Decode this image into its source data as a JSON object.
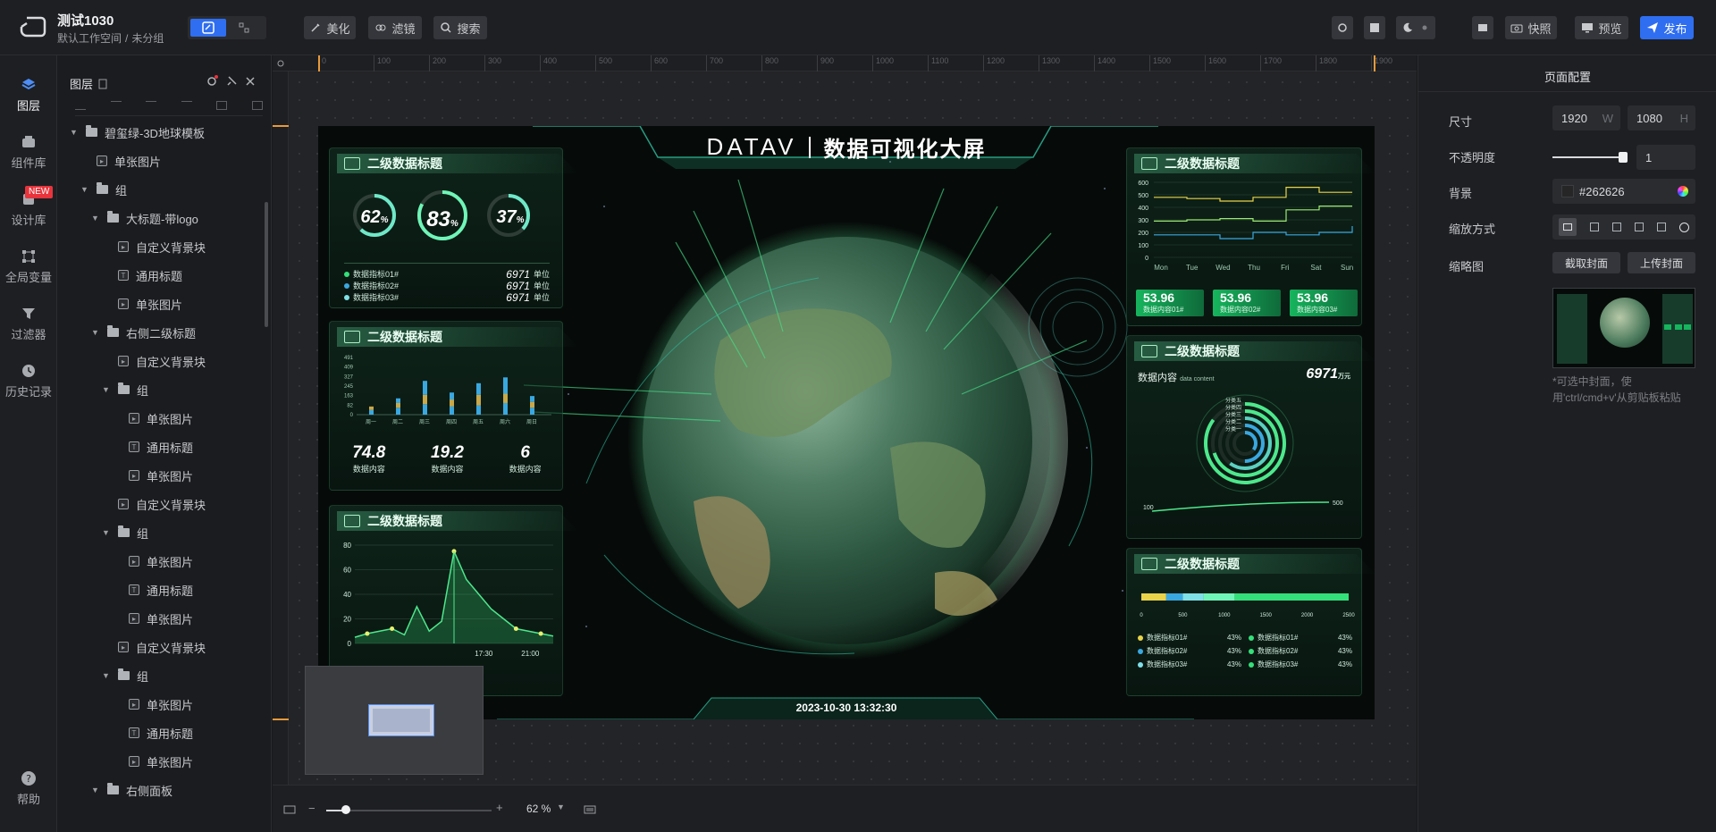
{
  "project": {
    "title": "测试1030",
    "workspace": "默认工作空间",
    "separator": "/",
    "group": "未分组"
  },
  "toolbar": {
    "beautify": "美化",
    "filter": "滤镜",
    "search": "搜索",
    "snapshot": "快照",
    "preview": "预览",
    "publish": "发布"
  },
  "leftnav": [
    {
      "label": "图层",
      "icon": "layers-icon"
    },
    {
      "label": "组件库",
      "icon": "component-icon"
    },
    {
      "label": "设计库",
      "icon": "design-icon",
      "badge": "NEW"
    },
    {
      "label": "全局变量",
      "icon": "variable-icon"
    },
    {
      "label": "过滤器",
      "icon": "filter-icon"
    },
    {
      "label": "历史记录",
      "icon": "history-icon"
    },
    {
      "label": "帮助",
      "icon": "help-icon"
    }
  ],
  "layers": {
    "title": "图层",
    "rows": [
      {
        "label": "碧玺绿-3D地球模板",
        "type": "folder",
        "indent": 0,
        "open": true
      },
      {
        "label": "单张图片",
        "type": "image",
        "indent": 1
      },
      {
        "label": "组",
        "type": "folder",
        "indent": 1,
        "open": true
      },
      {
        "label": "大标题-带logo",
        "type": "folder",
        "indent": 2,
        "open": true
      },
      {
        "label": "自定义背景块",
        "type": "image",
        "indent": 3
      },
      {
        "label": "通用标题",
        "type": "text",
        "indent": 3
      },
      {
        "label": "单张图片",
        "type": "image",
        "indent": 3
      },
      {
        "label": "右侧二级标题",
        "type": "folder",
        "indent": 2,
        "open": true
      },
      {
        "label": "自定义背景块",
        "type": "image",
        "indent": 3
      },
      {
        "label": "组",
        "type": "folder",
        "indent": 3,
        "open": true
      },
      {
        "label": "单张图片",
        "type": "image",
        "indent": 4
      },
      {
        "label": "通用标题",
        "type": "text",
        "indent": 4
      },
      {
        "label": "单张图片",
        "type": "image",
        "indent": 4
      },
      {
        "label": "自定义背景块",
        "type": "image",
        "indent": 3
      },
      {
        "label": "组",
        "type": "folder",
        "indent": 3,
        "open": true
      },
      {
        "label": "单张图片",
        "type": "image",
        "indent": 4
      },
      {
        "label": "通用标题",
        "type": "text",
        "indent": 4
      },
      {
        "label": "单张图片",
        "type": "image",
        "indent": 4
      },
      {
        "label": "自定义背景块",
        "type": "image",
        "indent": 3
      },
      {
        "label": "组",
        "type": "folder",
        "indent": 3,
        "open": true
      },
      {
        "label": "单张图片",
        "type": "image",
        "indent": 4
      },
      {
        "label": "通用标题",
        "type": "text",
        "indent": 4
      },
      {
        "label": "单张图片",
        "type": "image",
        "indent": 4
      },
      {
        "label": "右侧面板",
        "type": "folder",
        "indent": 2,
        "open": true
      }
    ]
  },
  "ruler": {
    "ticks": [
      "0",
      "100",
      "200",
      "300",
      "400",
      "500",
      "600",
      "700",
      "800",
      "900",
      "1000",
      "1100",
      "1200",
      "1300",
      "1400",
      "1500",
      "1600",
      "1700",
      "1800",
      "1900"
    ]
  },
  "bottombar": {
    "zoom": "62 %",
    "minus": "−",
    "plus": "+",
    "zoom_level": 0.12
  },
  "rightpanel": {
    "title": "页面配置",
    "size_label": "尺寸",
    "width": "1920",
    "w": "W",
    "height": "1080",
    "h": "H",
    "opacity_label": "不透明度",
    "opacity": "1",
    "bg_label": "背景",
    "bg": "#262626",
    "scale_label": "缩放方式",
    "thumb_label": "缩略图",
    "capture_cover": "截取封面",
    "upload_cover": "上传封面",
    "hint": "*可选中封面，使用'ctrl/cmd+v'从剪贴板粘贴"
  },
  "screen": {
    "brand": "DATAV",
    "title": "数据可视化大屏",
    "datetime": "2023-10-30 13:32:30",
    "panel_title": "二级数据标题",
    "rings": [
      {
        "value": "62",
        "unit": "%"
      },
      {
        "value": "83",
        "unit": "%"
      },
      {
        "value": "37",
        "unit": "%"
      }
    ],
    "legend_rows": [
      {
        "name": "数据指标01#",
        "value": "6971",
        "unit": "单位",
        "color": "#34e07a"
      },
      {
        "name": "数据指标02#",
        "value": "6971",
        "unit": "单位",
        "color": "#3aa8e0"
      },
      {
        "name": "数据指标03#",
        "value": "6971",
        "unit": "单位",
        "color": "#7fe0e8"
      }
    ],
    "bar_axis": [
      "491",
      "409",
      "327",
      "245",
      "163",
      "82",
      "0"
    ],
    "bar_cats": [
      "周一",
      "周二",
      "周三",
      "周四",
      "周五",
      "周六",
      "周日"
    ],
    "stats": [
      {
        "value": "74.8",
        "label": "数据内容"
      },
      {
        "value": "19.2",
        "label": "数据内容"
      },
      {
        "value": "6",
        "label": "数据内容"
      }
    ],
    "line_axis": [
      "80",
      "60",
      "40",
      "20",
      "0"
    ],
    "line_times": [
      "17:30",
      "21:00"
    ],
    "step_axis": [
      "600",
      "500",
      "400",
      "300",
      "200",
      "100",
      "0"
    ],
    "step_days": [
      "Mon",
      "Tue",
      "Wed",
      "Thu",
      "Fri",
      "Sat",
      "Sun"
    ],
    "green_boxes": [
      {
        "value": "53.96",
        "label": "数据内容01#"
      },
      {
        "value": "53.96",
        "label": "数据内容02#"
      },
      {
        "value": "53.96",
        "label": "数据内容03#"
      }
    ],
    "radial_title": "数据内容",
    "radial_sub": "data content",
    "radial_value": "6971",
    "radial_unit": "万元",
    "radial_labels": [
      "分类五",
      "分类四",
      "分类三",
      "分类二",
      "分类一"
    ],
    "radial_min": "100",
    "radial_max": "500",
    "hbar_axis": [
      "0",
      "500",
      "1000",
      "1500",
      "2000",
      "2500"
    ],
    "hbar_legend": [
      {
        "name": "数据指标01#",
        "value": "43%",
        "color": "#e8d34a"
      },
      {
        "name": "数据指标01#",
        "value": "43%",
        "color": "#34e07a"
      },
      {
        "name": "数据指标02#",
        "value": "43%",
        "color": "#3aa8e0"
      },
      {
        "name": "数据指标02#",
        "value": "43%",
        "color": "#34e07a"
      },
      {
        "name": "数据指标03#",
        "value": "43%",
        "color": "#7fe0e8"
      },
      {
        "name": "数据指标03#",
        "value": "43%",
        "color": "#34e07a"
      }
    ]
  }
}
